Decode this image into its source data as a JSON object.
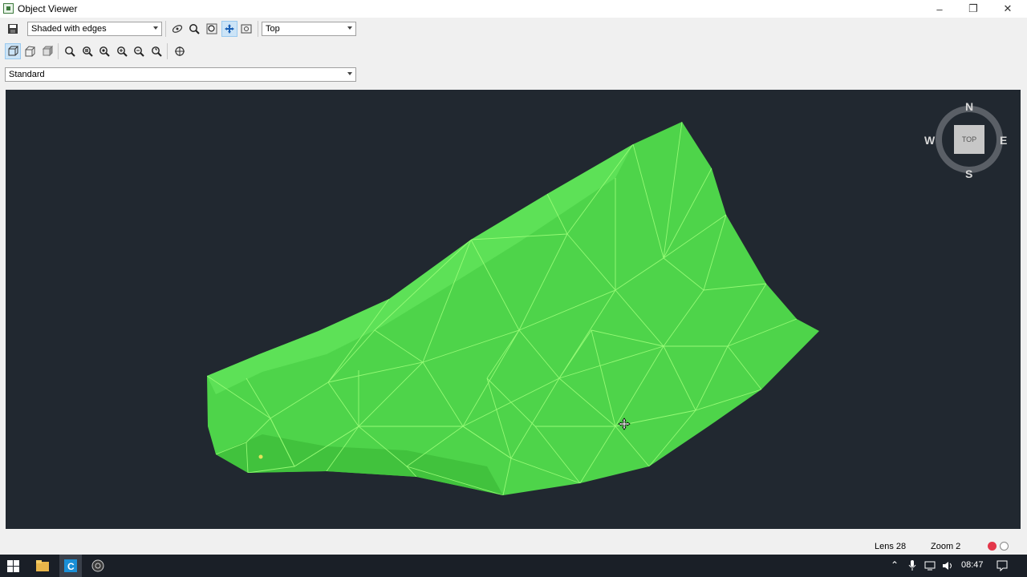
{
  "window": {
    "title": "Object Viewer",
    "controls": {
      "minimize": "–",
      "maximize": "❐",
      "close": "✕"
    }
  },
  "toolbar1": {
    "visual_style": "Shaded with edges",
    "view": "Top"
  },
  "toolbar3": {
    "visual_style_set": "Standard"
  },
  "viewcube": {
    "north": "N",
    "south": "S",
    "east": "E",
    "west": "W",
    "face": "TOP"
  },
  "statusbar": {
    "lens": "Lens 28",
    "zoom": "Zoom 2"
  },
  "taskbar": {
    "clock": "08:47"
  },
  "colors": {
    "viewport_bg": "#212830",
    "mesh_fill": "#4ed44a",
    "mesh_edge": "#9dff7a",
    "title_bar": "#ffffff",
    "taskbar": "#1a1f27"
  }
}
